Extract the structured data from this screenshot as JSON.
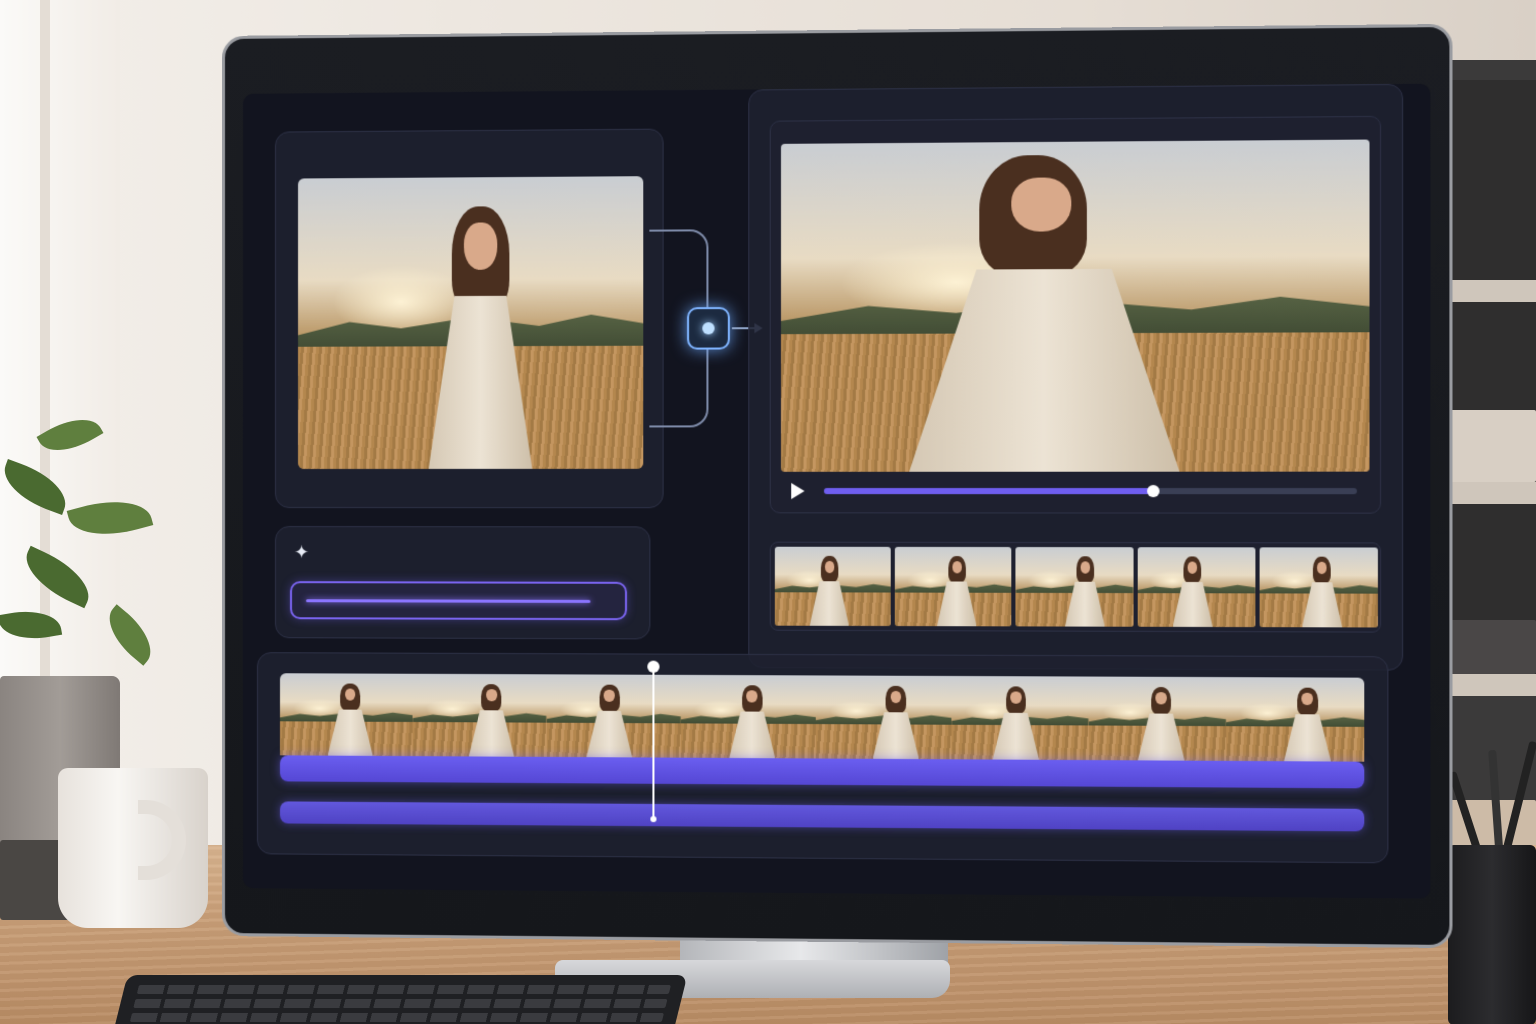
{
  "scene": {
    "accent_color": "#6f5ef0",
    "glow_color": "#7fb4ff",
    "screen_background": "#12141f"
  },
  "editor": {
    "source_panel": {
      "icon": "image-thumbnail"
    },
    "transform_node": {
      "icon": "node-dot-icon"
    },
    "prompt_panel": {
      "icon": "sparkle-icon",
      "glyph": "✦",
      "text": ""
    },
    "player": {
      "play_icon": "play-icon",
      "progress": 0.62
    },
    "frames_strip": {
      "frame_count": 5
    },
    "timeline": {
      "clip_count": 8,
      "playhead_position": 0.35
    }
  }
}
